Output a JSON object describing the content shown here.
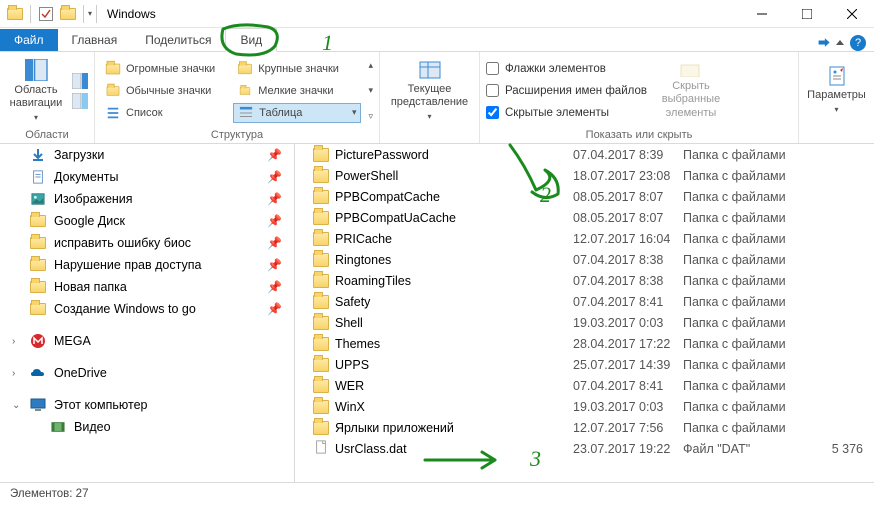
{
  "window": {
    "title": "Windows",
    "controls": {
      "minimize": "–",
      "maximize": "☐",
      "close": "✕"
    }
  },
  "ribbon": {
    "file_tab": "Файл",
    "tabs": [
      "Главная",
      "Поделиться",
      "Вид"
    ],
    "active_tab": "Вид",
    "groups": {
      "panes": {
        "label": "Области",
        "nav_pane": "Область навигации"
      },
      "layout": {
        "label": "Структура",
        "huge": "Огромные значки",
        "large": "Крупные значки",
        "medium": "Обычные значки",
        "small": "Мелкие значки",
        "list": "Список",
        "details": "Таблица"
      },
      "current": {
        "label": "Текущее представление",
        "btn": "Текущее представление"
      },
      "showhide": {
        "label": "Показать или скрыть",
        "item_checkboxes": "Флажки элементов",
        "item_checkboxes_checked": false,
        "file_ext": "Расширения имен файлов",
        "file_ext_checked": false,
        "hidden_items": "Скрытые элементы",
        "hidden_items_checked": true,
        "hide_selected": "Скрыть выбранные элементы"
      },
      "options": {
        "btn": "Параметры"
      }
    }
  },
  "sidebar": {
    "items": [
      {
        "name": "Загрузки",
        "icon": "download"
      },
      {
        "name": "Документы",
        "icon": "document"
      },
      {
        "name": "Изображения",
        "icon": "picture"
      },
      {
        "name": "Google Диск",
        "icon": "folder"
      },
      {
        "name": "исправить ошибку биос",
        "icon": "folder"
      },
      {
        "name": "Нарушение прав доступа",
        "icon": "folder"
      },
      {
        "name": "Новая папка",
        "icon": "folder"
      },
      {
        "name": "Создание Windows to go",
        "icon": "folder"
      }
    ],
    "mega": "MEGA",
    "onedrive": "OneDrive",
    "pc": "Этот компьютер",
    "video": "Видео"
  },
  "files": [
    {
      "name": "PicturePassword",
      "date": "07.04.2017 8:39",
      "type": "Папка с файлами",
      "size": ""
    },
    {
      "name": "PowerShell",
      "date": "18.07.2017 23:08",
      "type": "Папка с файлами",
      "size": ""
    },
    {
      "name": "PPBCompatCache",
      "date": "08.05.2017 8:07",
      "type": "Папка с файлами",
      "size": ""
    },
    {
      "name": "PPBCompatUaCache",
      "date": "08.05.2017 8:07",
      "type": "Папка с файлами",
      "size": ""
    },
    {
      "name": "PRICache",
      "date": "12.07.2017 16:04",
      "type": "Папка с файлами",
      "size": ""
    },
    {
      "name": "Ringtones",
      "date": "07.04.2017 8:38",
      "type": "Папка с файлами",
      "size": ""
    },
    {
      "name": "RoamingTiles",
      "date": "07.04.2017 8:38",
      "type": "Папка с файлами",
      "size": ""
    },
    {
      "name": "Safety",
      "date": "07.04.2017 8:41",
      "type": "Папка с файлами",
      "size": ""
    },
    {
      "name": "Shell",
      "date": "19.03.2017 0:03",
      "type": "Папка с файлами",
      "size": ""
    },
    {
      "name": "Themes",
      "date": "28.04.2017 17:22",
      "type": "Папка с файлами",
      "size": ""
    },
    {
      "name": "UPPS",
      "date": "25.07.2017 14:39",
      "type": "Папка с файлами",
      "size": ""
    },
    {
      "name": "WER",
      "date": "07.04.2017 8:41",
      "type": "Папка с файлами",
      "size": ""
    },
    {
      "name": "WinX",
      "date": "19.03.2017 0:03",
      "type": "Папка с файлами",
      "size": ""
    },
    {
      "name": "Ярлыки приложений",
      "date": "12.07.2017 7:56",
      "type": "Папка с файлами",
      "size": ""
    },
    {
      "name": "UsrClass.dat",
      "date": "23.07.2017 19:22",
      "type": "Файл \"DAT\"",
      "size": "5 376",
      "is_file": true
    }
  ],
  "status": {
    "count_label": "Элементов: 27"
  },
  "annotations": {
    "step1": "1",
    "step2": "2",
    "step3": "3"
  }
}
